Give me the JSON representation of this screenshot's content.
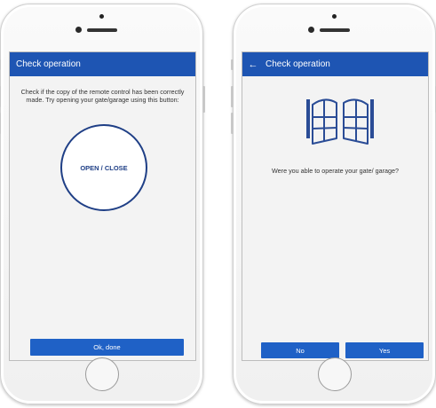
{
  "screen1": {
    "title": "Check operation",
    "instructions": "Check if the copy of the remote control has been correctly made. Try opening your gate/garage using this button:",
    "open_close_label": "OPEN / CLOSE",
    "ok_label": "Ok, done"
  },
  "screen2": {
    "back_icon": "←",
    "title": "Check operation",
    "question": "Were you able to operate your gate/ garage?",
    "no_label": "No",
    "yes_label": "Yes"
  },
  "colors": {
    "appbar": "#1e55b3",
    "button": "#1f61c6",
    "accent_dark": "#1f3f86",
    "background": "#f3f3f3"
  }
}
